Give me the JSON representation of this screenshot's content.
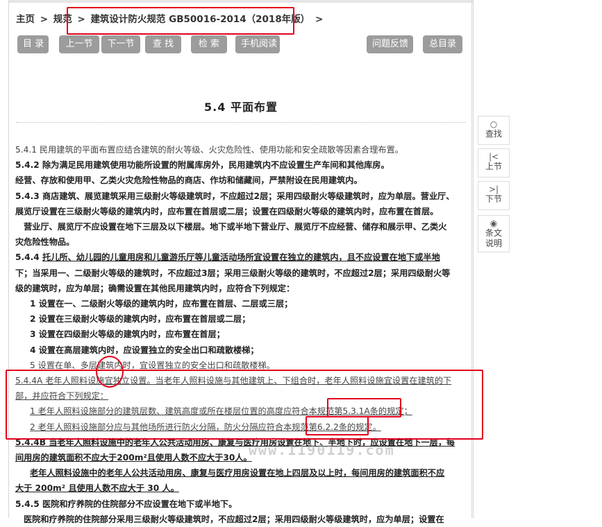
{
  "breadcrumb": {
    "home": "主页",
    "sep": ">",
    "level1": "规范",
    "current": "建筑设计防火规范 GB50016-2014（2018年版）"
  },
  "toolbar": {
    "toc": "目 录",
    "prev": "上一节",
    "next": "下一节",
    "find": "查 找",
    "search": "检 索",
    "mobile": "手机阅读",
    "feedback": "问题反馈",
    "master_toc": "总目录"
  },
  "section_title": "5.4 平面布置",
  "side_nav": {
    "find": {
      "icon": "search-icon",
      "label": "查找"
    },
    "prev": {
      "icon": "first-icon",
      "label_a": "上节"
    },
    "next": {
      "icon": "last-icon",
      "label_a": "下节"
    },
    "explain": {
      "icon": "eye-icon",
      "label_a": "条文",
      "label_b": "说明"
    }
  },
  "watermark": "www.1190119.com",
  "content": {
    "l1": "5.4.1 民用建筑的平面布置应结合建筑的耐火等级、火灾危险性、使用功能和安全疏散等因素合理布置。",
    "l2": "5.4.2 除为满足民用建筑使用功能所设置的附属库房外，民用建筑内不应设置生产车间和其他库房。",
    "l3": "经营、存放和使用甲、乙类火灾危险性物品的商店、作坊和储藏间，严禁附设在民用建筑内。",
    "l4": "5.4.3 商店建筑、展览建筑采用三级耐火等级建筑时，不应超过2层；采用四级耐火等级建筑时，应为单层。营业厅、",
    "l5": "展览厅设置在三级耐火等级的建筑内时，应布置在首层或二层；设置在四级耐火等级的建筑内时，应布置在首层。",
    "l6": "营业厅、展览厅不应设置在地下三层及以下楼层。地下或半地下营业厅、展览厅不应经营、储存和展示甲、乙类火",
    "l7": "灾危险性物品。",
    "l8a": "5.4.4 ",
    "l8b": "托儿所、幼儿园的儿童用房和儿童游乐厅等儿童活动场所宜设置在独立的建筑内，且不应设置在地下或半地",
    "l9": "下；当采用一、二级耐火等级的建筑时，不应超过3层；采用三级耐火等级的建筑时，不应超过2层；采用四级耐火等",
    "l10": "级的建筑时，应为单层；确需设置在其他民用建筑内时，应符合下列规定：",
    "l11": "1 设置在一、二级耐火等级的建筑内时，应布置在首层、二层或三层；",
    "l12": "2 设置在三级耐火等级的建筑内时，应布置在首层或二层；",
    "l13": "3 设置在四级耐火等级的建筑内时，应布置在首层；",
    "l14": "4 设置在高层建筑内时，应设置独立的安全出口和疏散楼梯；",
    "l15": "5 设置在单、多层建筑内时，宜设置独立的安全出口和疏散楼梯。",
    "l16": "5.4.4A 老年人照料设施宜独立设置。当老年人照料设施与其他建筑上、下组合时，老年人照料设施宜设置在建筑的下",
    "l17": "部，并应符合下列规定：",
    "l18": "1 老年人照料设施部分的建筑层数、建筑高度或所在楼层位置的高度应符合本规范第5.3.1A条的规定；",
    "l19": "2 老年人照料设施部分应与其他场所进行防火分隔，防火分隔应符合本规范第6.2.2条的规定。",
    "l20": "5.4.4B 当老年人照料设施中的老年人公共活动用房、康复与医疗用房设置在地下、半地下时，应设置在地下一层，每",
    "l21": "间用房的建筑面积不应大于200m²且使用人数不应大于30人。",
    "l22": "老年人照料设施中的老年人公共活动用房、康复与医疗用房设置在地上四层及以上时，每间用房的建筑面积不应",
    "l23": "大于 200m² 且使用人数不应大于 30 人。",
    "l24": "5.4.5 医院和疗养院的住院部分不应设置在地下或半地下。",
    "l25": "医院和疗养院的住院部分采用三级耐火等级建筑时，不应超过2层；采用四级耐火等级建筑时，应为单层；设置在"
  }
}
